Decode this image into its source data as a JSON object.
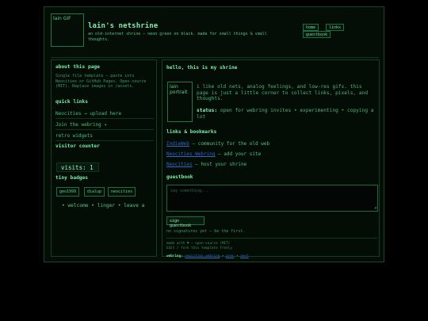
{
  "header": {
    "logo_alt": "lain GIF",
    "title": "lain's netshrine",
    "subtitle": "an old-internet shrine — neon green on black. made for small things & small thoughts.",
    "nav": [
      "home",
      "links",
      "guestbook"
    ]
  },
  "sidebar": {
    "about_heading": "about this page",
    "about_text": "Single file template — paste into Neocities or GitHub Pages. Open-source (MIT). Replace images in /assets.",
    "quick_links_heading": "quick links",
    "quick_links": [
      "Neocities → upload here",
      "Join the webring ✦",
      "retro widgets"
    ],
    "visitor_counter_heading": "visitor counter",
    "visits_text": "visits: 1",
    "badges_heading": "tiny badges",
    "badges": [
      "geo1999",
      "dialup",
      "neocities"
    ],
    "marquee": "• welcome • linger • leave a"
  },
  "main": {
    "heading": "hello, this is my shrine",
    "portrait_alt": "lain portrait",
    "intro": "i like old nets, analog feelings, and low-res gifs. this page is just a little corner to collect links, pixels, and thoughts.",
    "status_label": "status:",
    "status_text": "open for webring invites • experimenting • copying a lot",
    "bookmarks_heading": "links & bookmarks",
    "bookmarks": [
      {
        "link": "IndieWeb",
        "desc": "— community for the old web"
      },
      {
        "link": "Neocities Webring",
        "desc": "— add your site"
      },
      {
        "link": "Neocities",
        "desc": "— host your shrine"
      }
    ],
    "guestbook_heading": "guestbook",
    "guestbook_placeholder": "say something...",
    "sign_button": "sign guestbook",
    "no_signatures": "no signatures yet — be the first.",
    "footer_line1": "made with ♥ — open-source (MIT)",
    "footer_line2": "Edit / fork this template freely",
    "webring_label": "webring:",
    "webring_links": [
      "neocities webring",
      "prev",
      "next"
    ],
    "webring_sep": "•"
  },
  "colors": {
    "background": "#000000",
    "accent": "#78f0a8",
    "link_blue": "#2e67c9"
  }
}
